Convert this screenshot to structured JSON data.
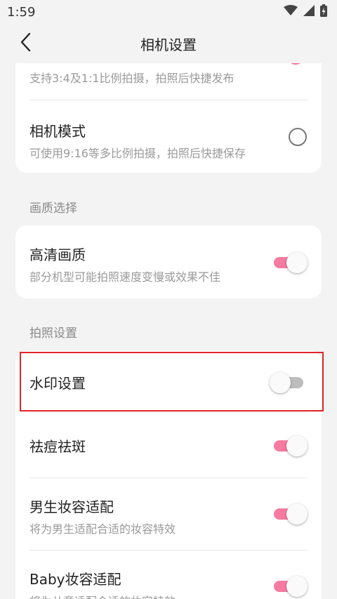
{
  "status_bar": {
    "time": "1:59",
    "icons": [
      "wifi-icon",
      "signal-icon",
      "battery-icon"
    ]
  },
  "header": {
    "title": "相机设置",
    "back_icon": "chevron-left-icon"
  },
  "mode_card": {
    "items": [
      {
        "title": "",
        "subtitle": "支持3:4及1:1比例拍摄，拍照后快捷发布",
        "checked": true
      },
      {
        "title": "相机模式",
        "subtitle": "可使用9:16等多比例拍摄，拍照后快捷保存",
        "checked": false
      }
    ]
  },
  "quality_section": {
    "label": "画质选择",
    "items": [
      {
        "title": "高清画质",
        "subtitle": "部分机型可能拍照速度变慢或效果不佳",
        "on": true
      }
    ]
  },
  "photo_section": {
    "label": "拍照设置",
    "items": [
      {
        "title": "水印设置",
        "subtitle": "",
        "on": false
      },
      {
        "title": "祛痘祛斑",
        "subtitle": "",
        "on": true
      },
      {
        "title": "男生妆容适配",
        "subtitle": "将为男生适配合适的妆容特效",
        "on": true
      },
      {
        "title": "Baby妆容适配",
        "subtitle": "将为儿童适配合适的妆容特效",
        "on": true
      }
    ]
  },
  "colors": {
    "accent": "#f76c94",
    "toggle_on_track": "#f77aa0",
    "toggle_off_track": "#bdbdbd",
    "highlight_border": "#e0252b",
    "background": "#f3f3f3"
  }
}
